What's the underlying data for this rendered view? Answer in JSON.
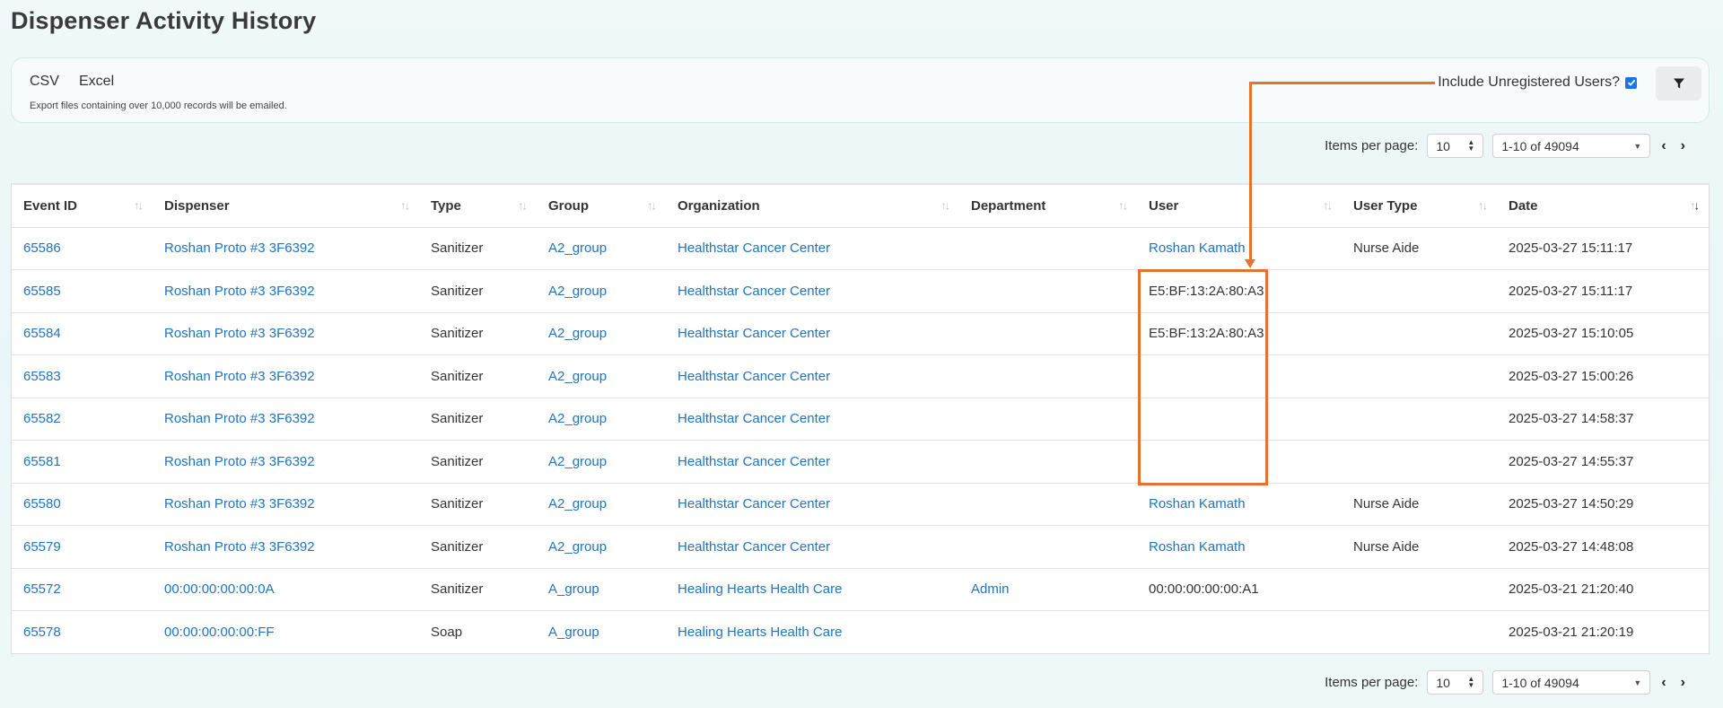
{
  "page": {
    "title": "Dispenser Activity History"
  },
  "export": {
    "csv_label": "CSV",
    "excel_label": "Excel",
    "note": "Export files containing over 10,000 records will be emailed."
  },
  "filters": {
    "include_unregistered_label": "Include Unregistered Users?",
    "include_unregistered_checked": true
  },
  "pagination": {
    "items_per_page_label": "Items per page:",
    "items_per_page": "10",
    "range": "1-10 of 49094"
  },
  "colors": {
    "link": "#2074c0",
    "annotation": "#e4732e",
    "checkbox": "#1a73e8"
  },
  "table": {
    "columns": [
      "Event ID",
      "Dispenser",
      "Type",
      "Group",
      "Organization",
      "Department",
      "User",
      "User Type",
      "Date"
    ],
    "rows": [
      {
        "event_id": "65586",
        "dispenser": "Roshan Proto #3 3F6392",
        "type": "Sanitizer",
        "group": "A2_group",
        "organization": "Healthstar Cancer Center",
        "department": "",
        "user": "Roshan Kamath",
        "user_link": true,
        "user_type": "Nurse Aide",
        "date": "2025-03-27 15:11:17"
      },
      {
        "event_id": "65585",
        "dispenser": "Roshan Proto #3 3F6392",
        "type": "Sanitizer",
        "group": "A2_group",
        "organization": "Healthstar Cancer Center",
        "department": "",
        "user": "E5:BF:13:2A:80:A3",
        "user_link": false,
        "user_type": "",
        "date": "2025-03-27 15:11:17"
      },
      {
        "event_id": "65584",
        "dispenser": "Roshan Proto #3 3F6392",
        "type": "Sanitizer",
        "group": "A2_group",
        "organization": "Healthstar Cancer Center",
        "department": "",
        "user": "E5:BF:13:2A:80:A3",
        "user_link": false,
        "user_type": "",
        "date": "2025-03-27 15:10:05"
      },
      {
        "event_id": "65583",
        "dispenser": "Roshan Proto #3 3F6392",
        "type": "Sanitizer",
        "group": "A2_group",
        "organization": "Healthstar Cancer Center",
        "department": "",
        "user": "",
        "user_link": false,
        "user_type": "",
        "date": "2025-03-27 15:00:26"
      },
      {
        "event_id": "65582",
        "dispenser": "Roshan Proto #3 3F6392",
        "type": "Sanitizer",
        "group": "A2_group",
        "organization": "Healthstar Cancer Center",
        "department": "",
        "user": "",
        "user_link": false,
        "user_type": "",
        "date": "2025-03-27 14:58:37"
      },
      {
        "event_id": "65581",
        "dispenser": "Roshan Proto #3 3F6392",
        "type": "Sanitizer",
        "group": "A2_group",
        "organization": "Healthstar Cancer Center",
        "department": "",
        "user": "",
        "user_link": false,
        "user_type": "",
        "date": "2025-03-27 14:55:37"
      },
      {
        "event_id": "65580",
        "dispenser": "Roshan Proto #3 3F6392",
        "type": "Sanitizer",
        "group": "A2_group",
        "organization": "Healthstar Cancer Center",
        "department": "",
        "user": "Roshan Kamath",
        "user_link": true,
        "user_type": "Nurse Aide",
        "date": "2025-03-27 14:50:29"
      },
      {
        "event_id": "65579",
        "dispenser": "Roshan Proto #3 3F6392",
        "type": "Sanitizer",
        "group": "A2_group",
        "organization": "Healthstar Cancer Center",
        "department": "",
        "user": "Roshan Kamath",
        "user_link": true,
        "user_type": "Nurse Aide",
        "date": "2025-03-27 14:48:08"
      },
      {
        "event_id": "65572",
        "dispenser": "00:00:00:00:00:0A",
        "type": "Sanitizer",
        "group": "A_group",
        "organization": "Healing Hearts Health Care",
        "department": "Admin",
        "user": "00:00:00:00:00:A1",
        "user_link": false,
        "user_type": "",
        "date": "2025-03-21 21:20:40"
      },
      {
        "event_id": "65578",
        "dispenser": "00:00:00:00:00:FF",
        "type": "Soap",
        "group": "A_group",
        "organization": "Healing Hearts Health Care",
        "department": "",
        "user": "",
        "user_link": false,
        "user_type": "",
        "date": "2025-03-21 21:20:19"
      }
    ]
  }
}
